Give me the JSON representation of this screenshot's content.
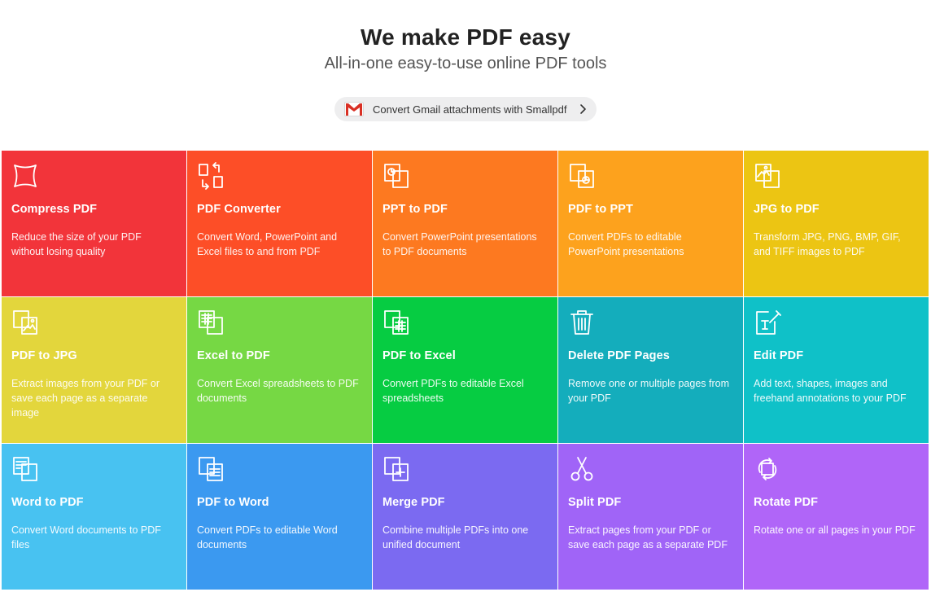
{
  "hero": {
    "title": "We make PDF easy",
    "subtitle": "All-in-one easy-to-use online PDF tools"
  },
  "gmail_promo": {
    "label": "Convert Gmail attachments with Smallpdf",
    "icon": "gmail-icon",
    "chevron": "chevron-right-icon"
  },
  "tools": [
    {
      "id": "compress-pdf",
      "title": "Compress PDF",
      "desc": "Reduce the size of your PDF without losing quality",
      "color": "#f2343a",
      "icon": "compress-icon"
    },
    {
      "id": "pdf-converter",
      "title": "PDF Converter",
      "desc": "Convert Word, PowerPoint and Excel files to and from PDF",
      "color": "#fd4e27",
      "icon": "convert-arrows-icon"
    },
    {
      "id": "ppt-to-pdf",
      "title": "PPT to PDF",
      "desc": "Convert PowerPoint presentations to PDF documents",
      "color": "#fd7920",
      "icon": "ppt-to-pdf-icon"
    },
    {
      "id": "pdf-to-ppt",
      "title": "PDF to PPT",
      "desc": "Convert PDFs to editable PowerPoint presentations",
      "color": "#fda21d",
      "icon": "pdf-to-ppt-icon"
    },
    {
      "id": "jpg-to-pdf",
      "title": "JPG to PDF",
      "desc": "Transform JPG, PNG, BMP, GIF, and TIFF images to PDF",
      "color": "#ecc513",
      "icon": "jpg-to-pdf-icon"
    },
    {
      "id": "pdf-to-jpg",
      "title": "PDF to JPG",
      "desc": "Extract images from your PDF or save each page as a separate image",
      "color": "#e3d63c",
      "icon": "pdf-to-jpg-icon"
    },
    {
      "id": "excel-to-pdf",
      "title": "Excel to PDF",
      "desc": "Convert Excel spreadsheets to PDF documents",
      "color": "#76d844",
      "icon": "excel-to-pdf-icon"
    },
    {
      "id": "pdf-to-excel",
      "title": "PDF to Excel",
      "desc": "Convert PDFs to editable Excel spreadsheets",
      "color": "#06cc42",
      "icon": "pdf-to-excel-icon"
    },
    {
      "id": "delete-pdf-pages",
      "title": "Delete PDF Pages",
      "desc": "Remove one or multiple pages from your PDF",
      "color": "#14adbc",
      "icon": "trash-icon"
    },
    {
      "id": "edit-pdf",
      "title": "Edit PDF",
      "desc": "Add text, shapes, images and freehand annotations to your PDF",
      "color": "#0fc1c8",
      "icon": "edit-pdf-icon"
    },
    {
      "id": "word-to-pdf",
      "title": "Word to PDF",
      "desc": "Convert Word documents to PDF files",
      "color": "#48c2f1",
      "icon": "word-to-pdf-icon"
    },
    {
      "id": "pdf-to-word",
      "title": "PDF to Word",
      "desc": "Convert PDFs to editable Word documents",
      "color": "#3b99f0",
      "icon": "pdf-to-word-icon"
    },
    {
      "id": "merge-pdf",
      "title": "Merge PDF",
      "desc": "Combine multiple PDFs into one unified document",
      "color": "#7b6af1",
      "icon": "merge-icon"
    },
    {
      "id": "split-pdf",
      "title": "Split PDF",
      "desc": "Extract pages from your PDF or save each page as a separate PDF",
      "color": "#a064f7",
      "icon": "scissors-icon"
    },
    {
      "id": "rotate-pdf",
      "title": "Rotate PDF",
      "desc": "Rotate one or all pages in your PDF",
      "color": "#b065f8",
      "icon": "rotate-icon"
    }
  ]
}
